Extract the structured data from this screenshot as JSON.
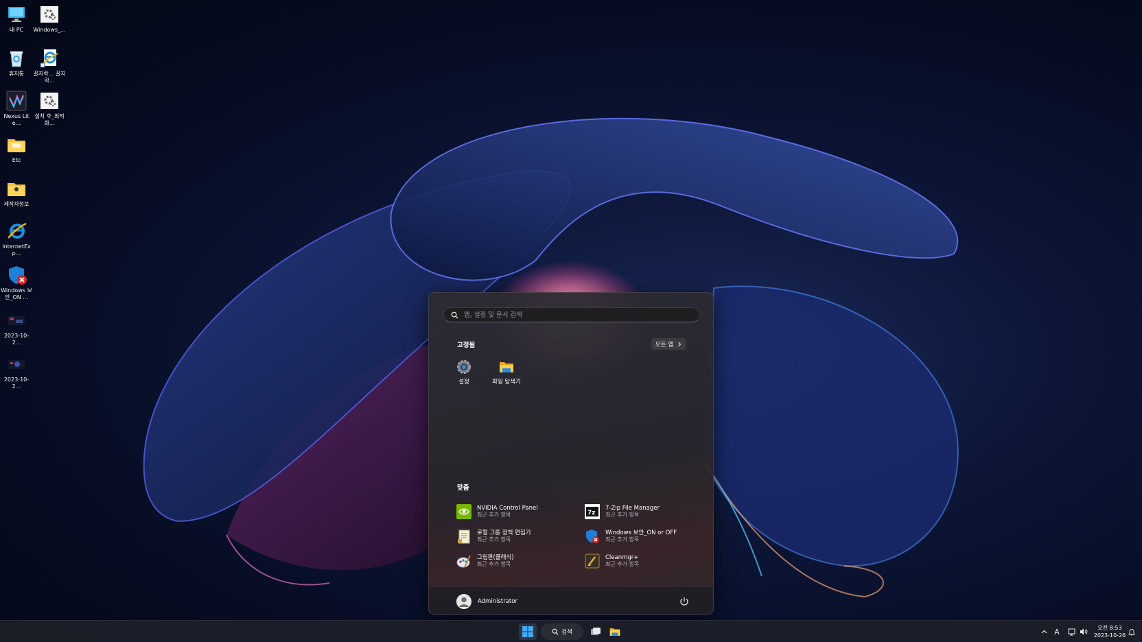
{
  "desktop": {
    "icons": [
      {
        "label": "내 PC",
        "icon": "computer-icon"
      },
      {
        "label": "Windows_...",
        "icon": "settings-gear-icon"
      },
      {
        "label": "휴지통",
        "icon": "recycle-bin-icon"
      },
      {
        "label": "꿀지락... 꿀지락...",
        "icon": "internet-explorer-document-icon"
      },
      {
        "label": "Nexus Lite...",
        "icon": "nexus-app-icon"
      },
      {
        "label": "설치 후_최적화...",
        "icon": "settings-gear-icon"
      },
      {
        "label": "Etc",
        "icon": "folder-icon"
      },
      {
        "label": "제작자정보",
        "icon": "folder-icon"
      },
      {
        "label": "InternetExp...",
        "icon": "internet-explorer-icon"
      },
      {
        "label": "Windows 보안_ON ...",
        "icon": "windows-security-off-icon"
      },
      {
        "label": "2023-10-2...",
        "icon": "screenshot-thumbnail-icon"
      },
      {
        "label": "2023-10-2...",
        "icon": "screenshot-thumbnail-icon"
      }
    ]
  },
  "start_menu": {
    "search_placeholder": "앱, 설정 및 문서 검색",
    "pinned_title": "고정됨",
    "all_apps_label": "모든 앱",
    "pinned_apps": [
      {
        "label": "설정",
        "icon": "settings-icon"
      },
      {
        "label": "파일 탐색기",
        "icon": "file-explorer-icon"
      }
    ],
    "recommended_title": "맞춤",
    "recommended": [
      {
        "title": "NVIDIA Control Panel",
        "subtitle": "최근 추가 항목",
        "icon": "nvidia-icon"
      },
      {
        "title": "7-Zip File Manager",
        "subtitle": "최근 추가 항목",
        "icon": "7zip-icon"
      },
      {
        "title": "로컬 그룹 정책 편집기",
        "subtitle": "최근 추가 항목",
        "icon": "group-policy-icon"
      },
      {
        "title": "Windows 보안_ON or OFF",
        "subtitle": "최근 추가 항목",
        "icon": "windows-security-off-icon"
      },
      {
        "title": "그림판(클래식)",
        "subtitle": "최근 추가 항목",
        "icon": "paint-icon"
      },
      {
        "title": "Cleanmgr+",
        "subtitle": "최근 추가 항목",
        "icon": "cleanmgr-icon"
      }
    ],
    "user_name": "Administrator"
  },
  "taskbar": {
    "search_label": "검색",
    "tray": {
      "ime_label": "A",
      "clock_time": "오전 8:53",
      "clock_date": "2023-10-26"
    }
  },
  "colors": {
    "accent": "#0078d4",
    "folder": "#f3c140",
    "nvidia": "#76b900"
  }
}
